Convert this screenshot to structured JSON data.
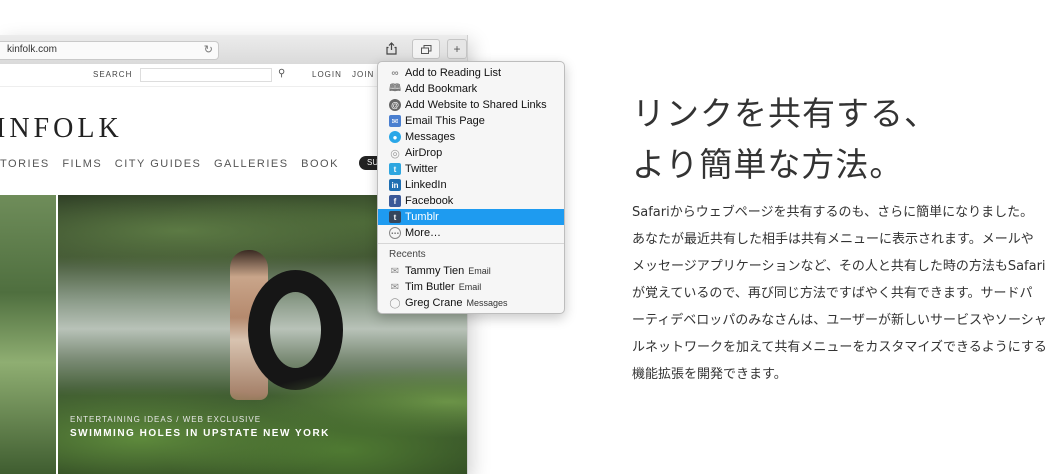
{
  "browser": {
    "url": "kinfolk.com",
    "icons": {
      "reload": "reload-icon",
      "share": "share-icon",
      "tabs": "tabs-icon",
      "new_tab": "plus-icon"
    }
  },
  "site": {
    "nav": {
      "search_label": "SEARCH",
      "login": "LOGIN",
      "join": "JOIN"
    },
    "logo": "INFOLK",
    "menu": [
      "TORIES",
      "FILMS",
      "CITY GUIDES",
      "GALLERIES",
      "BOOK"
    ],
    "subscribe_fragment": "SU",
    "caption": {
      "kicker": "ENTERTAINING IDEAS / WEB EXCLUSIVE",
      "title": "SWIMMING HOLES IN UPSTATE NEW YORK"
    }
  },
  "share_menu": {
    "items": [
      {
        "label": "Add to Reading List",
        "icon": "glasses-icon",
        "color": "#8a8a8a"
      },
      {
        "label": "Add Bookmark",
        "icon": "book-icon",
        "color": "#8a8a8a"
      },
      {
        "label": "Add Website to Shared Links",
        "icon": "at-icon",
        "color": "#6a6a6a"
      },
      {
        "label": "Email This Page",
        "icon": "mail-stamp-icon",
        "color": "#4a7fd0"
      },
      {
        "label": "Messages",
        "icon": "messages-icon",
        "color": "#2aa7e8"
      },
      {
        "label": "AirDrop",
        "icon": "airdrop-icon",
        "color": "#9a9a9a"
      },
      {
        "label": "Twitter",
        "icon": "twitter-icon",
        "color": "#2ea6e0"
      },
      {
        "label": "LinkedIn",
        "icon": "linkedin-icon",
        "color": "#1f6fb2"
      },
      {
        "label": "Facebook",
        "icon": "facebook-icon",
        "color": "#3b5998"
      },
      {
        "label": "Tumblr",
        "icon": "tumblr-icon",
        "color": "#35465c",
        "selected": true
      },
      {
        "label": "More…",
        "icon": "more-icon",
        "color": "#8a8a8a"
      }
    ],
    "recents_header": "Recents",
    "recents": [
      {
        "name": "Tammy Tien",
        "via": "Email",
        "icon": "mail-icon"
      },
      {
        "name": "Tim Butler",
        "via": "Email",
        "icon": "mail-icon"
      },
      {
        "name": "Greg Crane",
        "via": "Messages",
        "icon": "message-bubble-icon"
      }
    ],
    "selection_color": "#1e9bf0"
  },
  "feature": {
    "headline_line1": "リンクを共有する、",
    "headline_line2": "より簡単な方法。",
    "body_lines": [
      "Safariからウェブページを共有するのも、さらに簡単になりました。",
      "あなたが最近共有した相手は共有メニューに表示されます。メールや",
      "メッセージアプリケーションなど、その人と共有した時の方法もSafari",
      "が覚えているので、再び同じ方法ですばやく共有できます。サードパ",
      "ーティデベロッパのみなさんは、ユーザーが新しいサービスやソーシャ",
      "ルネットワークを加えて共有メニューをカスタマイズできるようにする",
      "機能拡張を開発できます。"
    ]
  }
}
